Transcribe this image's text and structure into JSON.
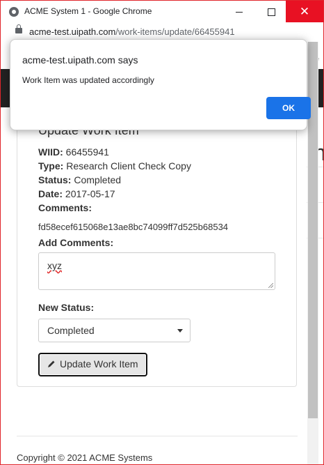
{
  "window": {
    "title": "ACME System 1 - Google Chrome"
  },
  "address": {
    "host": "acme-test.uipath.com",
    "path": "/work-items/update/66455941"
  },
  "background": {
    "partial_text": "e",
    "partial_letter": "n"
  },
  "form": {
    "title": "Update Work Item",
    "wiid_label": "WIID:",
    "wiid": "66455941",
    "type_label": "Type:",
    "type": "Research Client Check Copy",
    "status_label": "Status:",
    "status": "Completed",
    "date_label": "Date:",
    "date": "2017-05-17",
    "comments_label": "Comments:",
    "comments": "fd58ecef615068e13ae8bc74099ff7d525b68534",
    "add_comments_label": "Add Comments:",
    "add_comments_value": "xyz",
    "new_status_label": "New Status:",
    "new_status_value": "Completed",
    "submit_label": "Update Work Item"
  },
  "footer": {
    "text": "Copyright © 2021 ACME Systems"
  },
  "dialog": {
    "title": "acme-test.uipath.com says",
    "message": "Work Item was updated accordingly",
    "ok_label": "OK"
  },
  "colors": {
    "accent": "#1a73e8",
    "close": "#e81123",
    "frame": "#e0252b"
  }
}
